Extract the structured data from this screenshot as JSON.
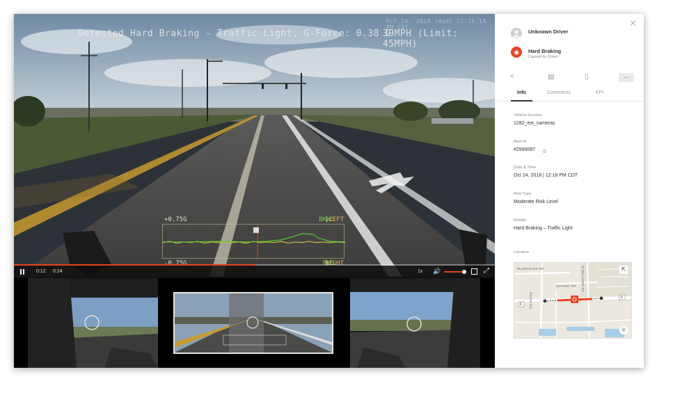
{
  "video": {
    "event_caption": "Detected Hard Braking - Traffic Light, G-Force: 0.38 G",
    "speed_text": "39MPH (Limit: 45MPH)",
    "timestamp_text": "Oct 24, 2018 (Wed) 12:18:14 PM CDT",
    "gforce": {
      "positive_label": "+0.75G",
      "negative_label": "-0.75G",
      "top_left_axis": "BKWD",
      "top_right_axis": "LEFT",
      "bottom_left_axis": "FWD",
      "bottom_right_axis": "RIGHT",
      "separator": "|"
    }
  },
  "controls": {
    "time_current": "0:12",
    "time_total": "0:24",
    "playback_rate": "1x",
    "progress_fraction": 0.5,
    "volume_fraction": 0.9,
    "accent_color": "#e8431f"
  },
  "panel": {
    "driver_name": "Unknown Driver",
    "event_title": "Hard Braking",
    "event_subtitle": "Caused by Driver",
    "more_label": "...",
    "tabs": {
      "info": "Info",
      "comments": "Comments",
      "kpi": "KPI"
    },
    "fields": [
      {
        "label": "Vehicle Number",
        "value": "1282_ext_cameras"
      },
      {
        "label": "Alert Id",
        "value": "#2999097"
      },
      {
        "label": "Date & Time",
        "value": "Oct 24, 2018 | 12:18 PM CDT"
      },
      {
        "label": "Risk Type",
        "value": "Moderate Risk Level"
      },
      {
        "label": "Details",
        "value": "Hard Braking – Traffic Light"
      }
    ],
    "location_label": "Location",
    "map": {
      "street_bluegrass": "BLUEGRASS DR",
      "street_saxony": "SAXONY DR",
      "street_ridge": "RIDGE RD",
      "street_williams": "N WILLIAMS ST",
      "route_left": "6",
      "route_right": "6"
    }
  }
}
